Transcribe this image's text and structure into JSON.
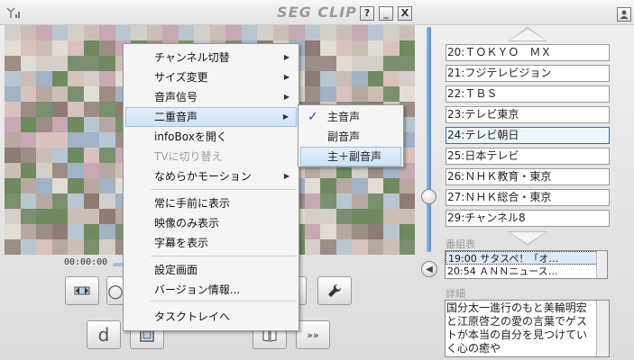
{
  "app": {
    "title": "SEG CLIP"
  },
  "titlebar": {
    "help_label": "?",
    "min_label": "_",
    "close_label": "X"
  },
  "player": {
    "time": "00:00:00"
  },
  "controls": {
    "d_label": "d",
    "next_label": "»»"
  },
  "channels": [
    {
      "label": "20:ＴＯＫＹＯ　ＭＸ",
      "selected": false
    },
    {
      "label": "21:フジテレビジョン",
      "selected": false
    },
    {
      "label": "22:ＴＢＳ",
      "selected": false
    },
    {
      "label": "23:テレビ東京",
      "selected": false
    },
    {
      "label": "24:テレビ朝日",
      "selected": true
    },
    {
      "label": "25:日本テレビ",
      "selected": false
    },
    {
      "label": "26:ＮＨＫ教育・東京",
      "selected": false
    },
    {
      "label": "27:ＮＨＫ総合・東京",
      "selected": false
    },
    {
      "label": "29:チャンネル8",
      "selected": false
    }
  ],
  "epg": {
    "label": "番組表",
    "rows": [
      "19:00 サタスペ！「オ…",
      "20:54 ＡＮＮニュース…"
    ]
  },
  "detail": {
    "label": "詳細",
    "text": "国分太一進行のもと美輪明宏と江原啓之の愛の言葉でゲストが本当の自分を見つけていく心の癒や"
  },
  "menu": {
    "items": [
      {
        "label": "チャンネル切替",
        "submenu": true
      },
      {
        "label": "サイズ変更",
        "submenu": true
      },
      {
        "label": "音声信号",
        "submenu": true
      },
      {
        "label": "二重音声",
        "submenu": true,
        "highlighted": true
      },
      {
        "label": "infoBoxを開く"
      },
      {
        "label": "TVに切り替え",
        "disabled": true
      },
      {
        "label": "なめらかモーション",
        "submenu": true
      },
      {
        "label": "常に手前に表示"
      },
      {
        "label": "映像のみ表示"
      },
      {
        "label": "字幕を表示"
      },
      {
        "label": "設定画面"
      },
      {
        "label": "バージョン情報..."
      },
      {
        "label": "タスクトレイへ"
      }
    ],
    "submenu_arrow": "▶"
  },
  "submenu": {
    "items": [
      {
        "label": "主音声",
        "checked": true
      },
      {
        "label": "副音声"
      },
      {
        "label": "主＋副音声",
        "highlighted": true
      }
    ],
    "check_glyph": "✓"
  },
  "colors": {
    "accent": "#3a6ea5",
    "highlight": "#cfe2f8"
  }
}
